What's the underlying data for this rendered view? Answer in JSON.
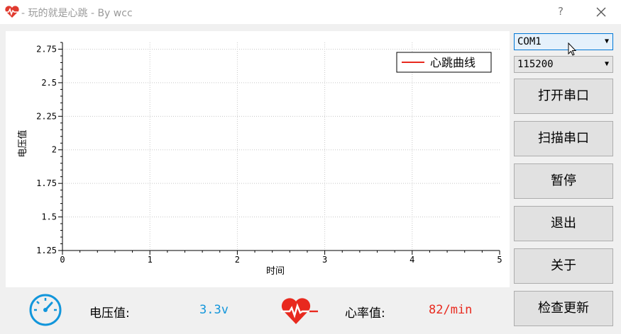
{
  "window": {
    "title": "- 玩的就是心跳 - By wcc",
    "help_label": "?"
  },
  "chart_data": {
    "type": "line",
    "title": "",
    "xlabel": "时间",
    "ylabel": "电压值",
    "xlim": [
      0,
      5
    ],
    "ylim": [
      1.25,
      2.8
    ],
    "x_ticks": [
      "0",
      "1",
      "2",
      "3",
      "4",
      "5"
    ],
    "y_ticks": [
      "1.25",
      "1.5",
      "1.75",
      "2",
      "2.25",
      "2.5",
      "2.75"
    ],
    "y_tick_values": [
      1.25,
      1.5,
      1.75,
      2,
      2.25,
      2.5,
      2.75
    ],
    "grid": true,
    "legend_position": "top-right",
    "series": [
      {
        "name": "心跳曲线",
        "color": "#e8291e",
        "x": [],
        "y": []
      }
    ]
  },
  "controls": {
    "port_combo": {
      "selected": "COM1"
    },
    "baud_combo": {
      "selected": "115200"
    },
    "open_port": "打开串口",
    "scan_port": "扫描串口",
    "pause": "暂停",
    "exit": "退出",
    "about": "关于",
    "check_update": "检查更新"
  },
  "status": {
    "voltage_label": "电压值:",
    "voltage_value": "3.3v",
    "heart_label": "心率值:",
    "heart_value": "82/min",
    "voltage_color": "#1296db",
    "heart_color": "#e8291e"
  },
  "icons": {
    "app": "heart-icon",
    "gauge": "gauge-icon",
    "heartbeat": "heartbeat-icon",
    "close": "close-icon",
    "dropdown": "dropdown-arrow-icon",
    "cursor": "mouse-cursor-icon"
  }
}
